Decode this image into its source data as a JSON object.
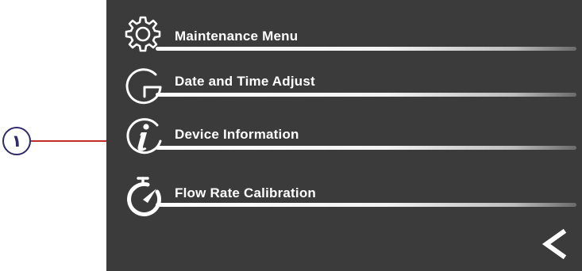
{
  "menu": {
    "items": [
      {
        "label": "Maintenance Menu",
        "icon": "gear-icon"
      },
      {
        "label": "Date and Time Adjust",
        "icon": "clock-icon"
      },
      {
        "label": "Device Information",
        "icon": "info-icon"
      },
      {
        "label": "Flow Rate Calibration",
        "icon": "stopwatch-icon"
      }
    ]
  },
  "navigation": {
    "back_icon": "chevron-left-icon"
  },
  "callout": {
    "number": "١",
    "line_color": "#c42a2a",
    "badge_color": "#2e2a6b"
  },
  "colors": {
    "screen_background": "#3b3b3b",
    "text": "#ffffff"
  }
}
